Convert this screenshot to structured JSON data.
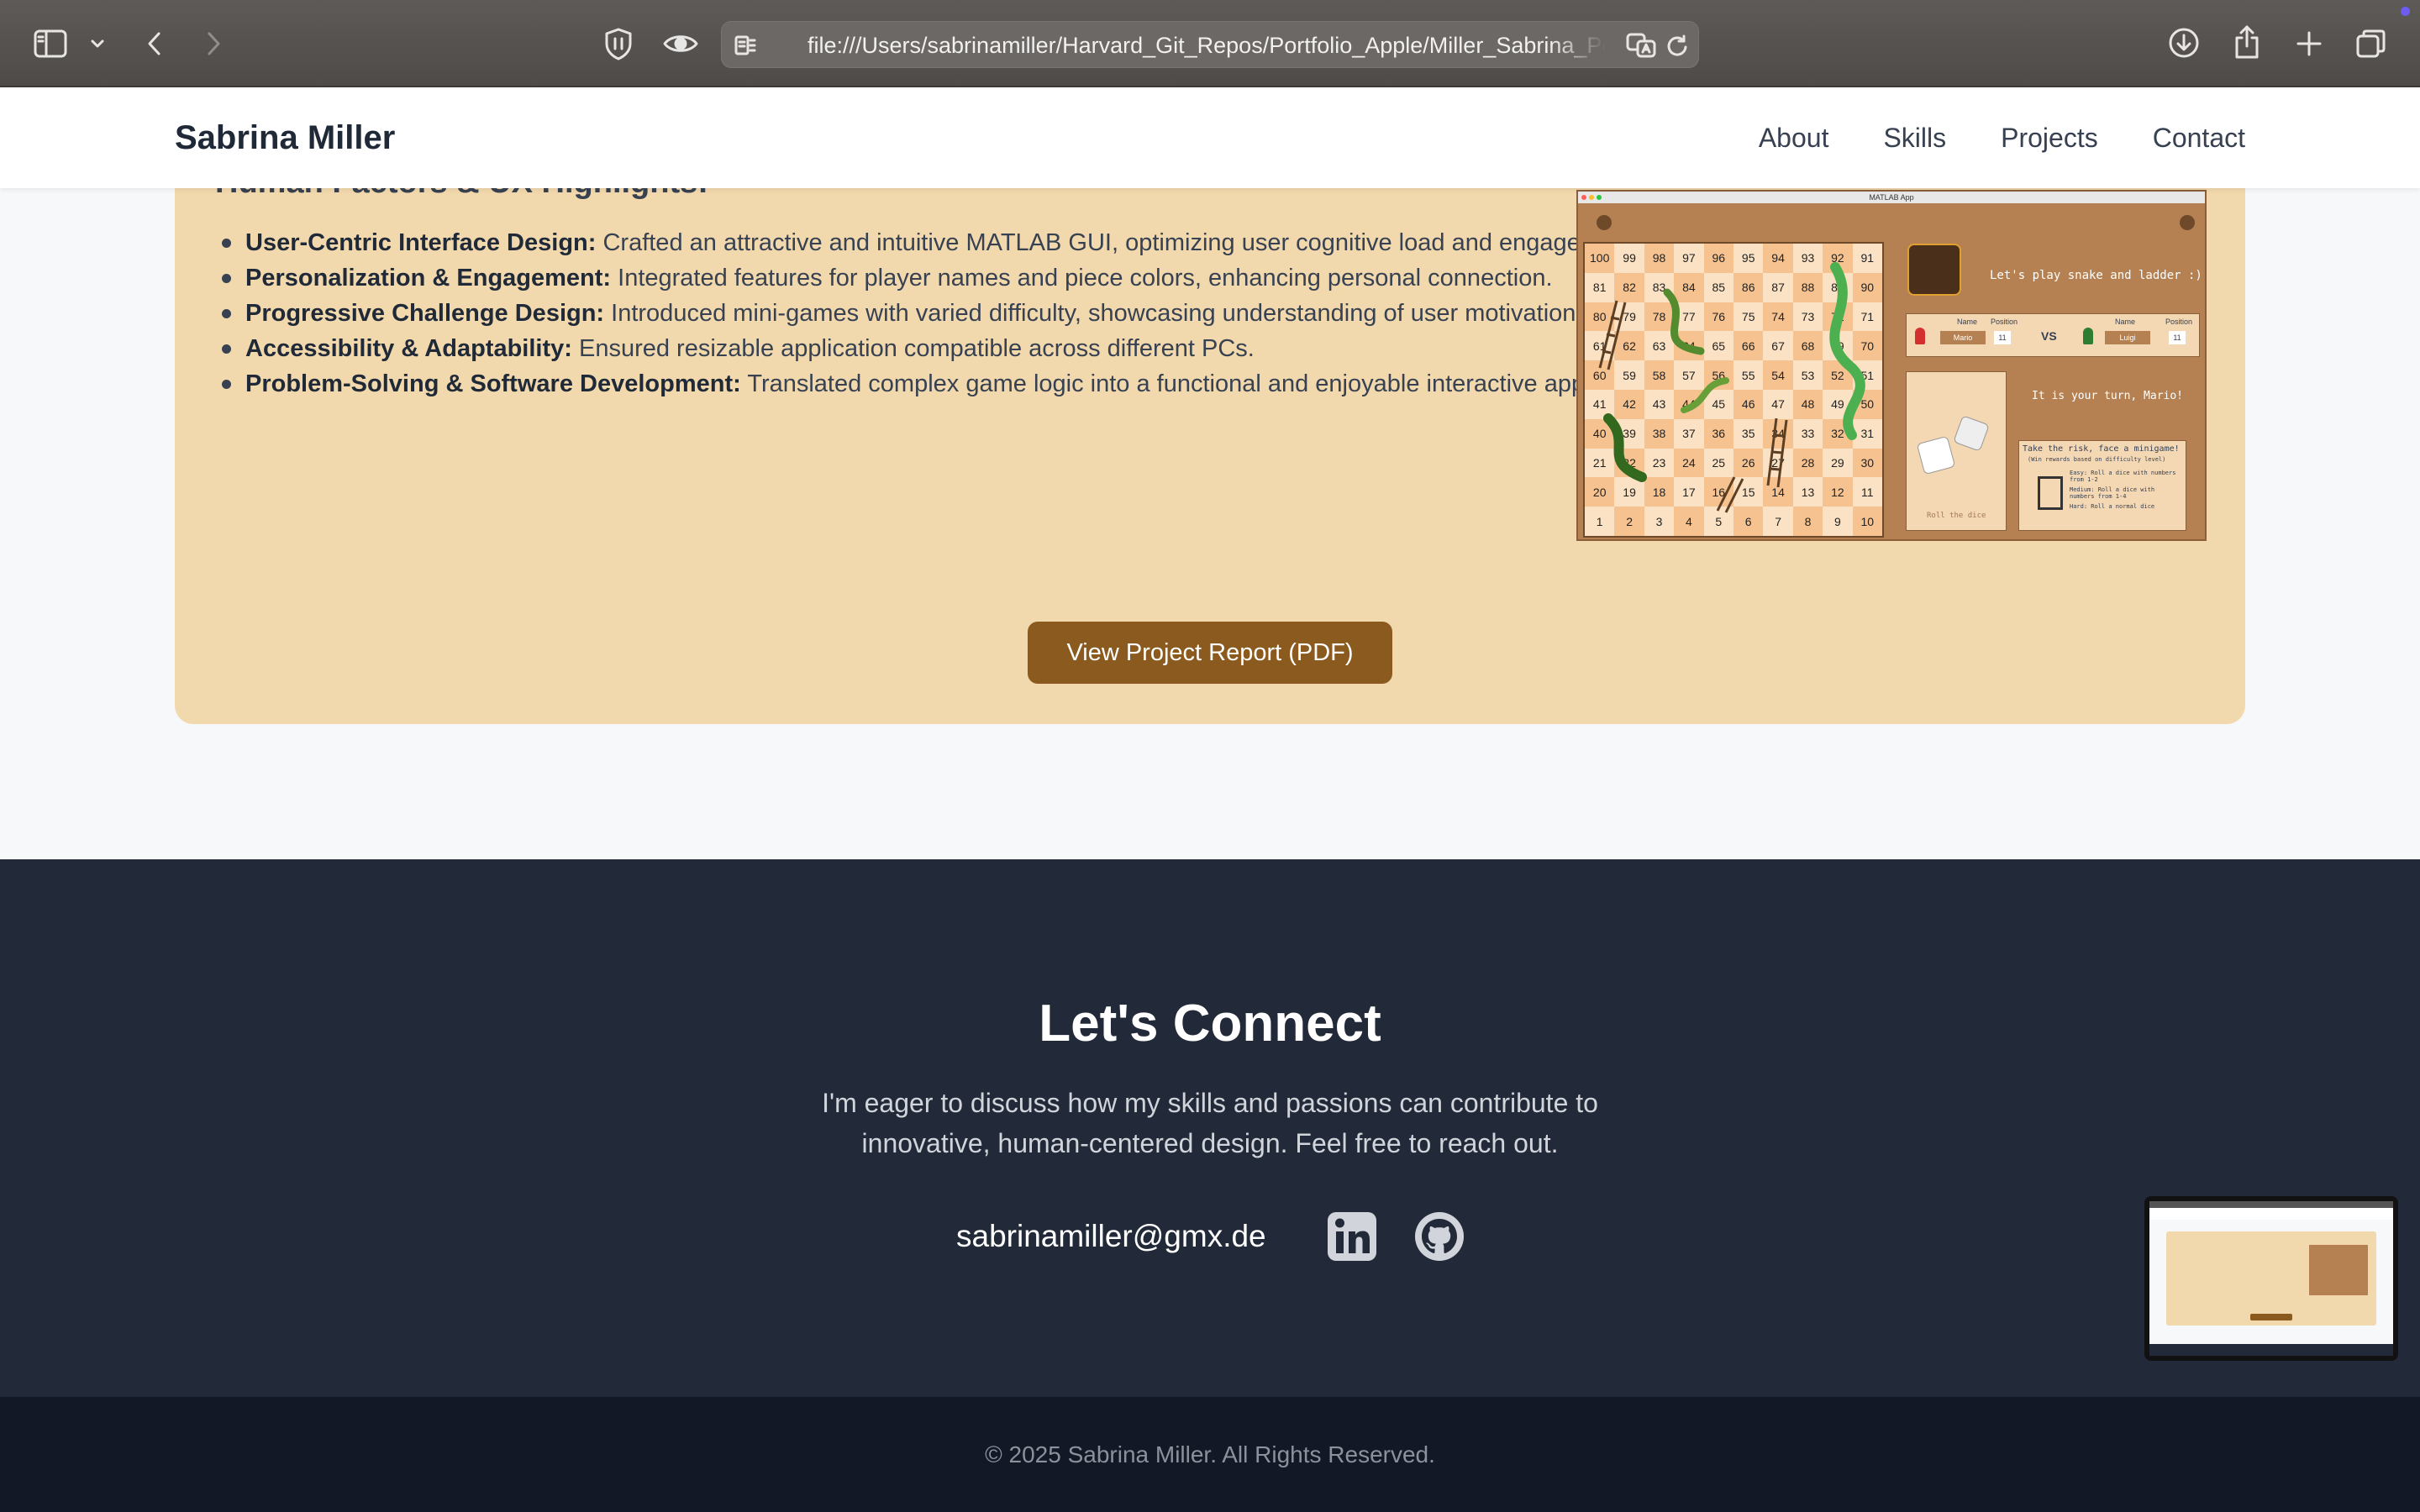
{
  "browser": {
    "url": "file:///Users/sabrinamiller/Harvard_Git_Repos/Portfolio_Apple/Miller_Sabrina_Portfolio.html"
  },
  "site": {
    "brand": "Sabrina Miller",
    "nav": [
      "About",
      "Skills",
      "Projects",
      "Contact"
    ]
  },
  "project": {
    "heading": "Human Factors & UX Highlights:",
    "highlights": [
      {
        "title": "User-Centric Interface Design:",
        "text": "Crafted an attractive and intuitive MATLAB GUI, optimizing user cognitive load and engagement."
      },
      {
        "title": "Personalization & Engagement:",
        "text": "Integrated features for player names and piece colors, enhancing personal connection."
      },
      {
        "title": "Progressive Challenge Design:",
        "text": "Introduced mini-games with varied difficulty, showcasing understanding of user motivation."
      },
      {
        "title": "Accessibility & Adaptability:",
        "text": "Ensured resizable application compatible across different PCs."
      },
      {
        "title": "Problem-Solving & Software Development:",
        "text": "Translated complex game logic into a functional and enjoyable interactive application."
      }
    ],
    "report_button": "View Project Report (PDF)",
    "game": {
      "window_title": "MATLAB App",
      "greeting": "Let's play snake and ladder :)",
      "col_name": "Name",
      "col_position": "Position",
      "player1": "Mario",
      "player1_pos": "11",
      "vs": "VS",
      "player2": "Luigi",
      "player2_pos": "11",
      "turn": "It is your turn, Mario!",
      "roll": "Roll the dice",
      "risk": "Take the risk, face a minigame!",
      "risk_sub": "(Win rewards based on difficulty level)",
      "risk_easy": "Easy: Roll a dice with numbers from 1-2",
      "risk_medium": "Medium: Roll a dice with numbers from 1-4",
      "risk_hard": "Hard: Roll a normal dice",
      "board_rows": [
        [
          "100",
          "99",
          "98",
          "97",
          "96",
          "95",
          "94",
          "93",
          "92",
          "91"
        ],
        [
          "81",
          "82",
          "83",
          "84",
          "85",
          "86",
          "87",
          "88",
          "89",
          "90"
        ],
        [
          "80",
          "79",
          "78",
          "77",
          "76",
          "75",
          "74",
          "73",
          "72",
          "71"
        ],
        [
          "61",
          "62",
          "63",
          "64",
          "65",
          "66",
          "67",
          "68",
          "69",
          "70"
        ],
        [
          "60",
          "59",
          "58",
          "57",
          "56",
          "55",
          "54",
          "53",
          "52",
          "51"
        ],
        [
          "41",
          "42",
          "43",
          "44",
          "45",
          "46",
          "47",
          "48",
          "49",
          "50"
        ],
        [
          "40",
          "39",
          "38",
          "37",
          "36",
          "35",
          "34",
          "33",
          "32",
          "31"
        ],
        [
          "21",
          "22",
          "23",
          "24",
          "25",
          "26",
          "27",
          "28",
          "29",
          "30"
        ],
        [
          "20",
          "19",
          "18",
          "17",
          "16",
          "15",
          "14",
          "13",
          "12",
          "11"
        ],
        [
          "1",
          "2",
          "3",
          "4",
          "5",
          "6",
          "7",
          "8",
          "9",
          "10"
        ]
      ]
    }
  },
  "connect": {
    "title": "Let's Connect",
    "text": "I'm eager to discuss how my skills and passions can contribute to innovative, human-centered design. Feel free to reach out.",
    "email": "sabrinamiller@gmx.de"
  },
  "footer": {
    "copyright": "© 2025 Sabrina Miller. All Rights Reserved."
  },
  "colors": {
    "card": "#f2d9ad",
    "accent_button": "#8b5a1e",
    "footer_dark": "#222938",
    "footer_bottom": "#131827"
  },
  "icons": [
    "sidebar-icon",
    "chevron-down-icon",
    "back-icon",
    "forward-icon",
    "shield-icon",
    "eye-icon",
    "reader-icon",
    "translate-icon",
    "reload-icon",
    "download-icon",
    "share-icon",
    "new-tab-icon",
    "tabs-overview-icon",
    "linkedin-icon",
    "github-icon"
  ]
}
